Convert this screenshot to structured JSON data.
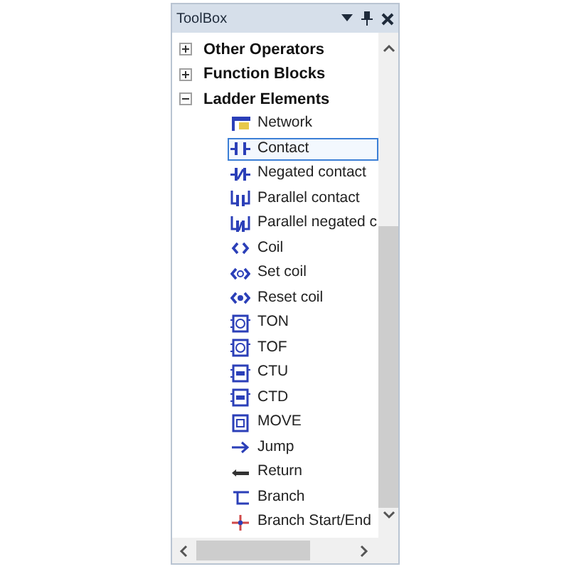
{
  "window": {
    "title": "ToolBox"
  },
  "tree": [
    {
      "label": "Other Operators",
      "expanded": false
    },
    {
      "label": "Function Blocks",
      "expanded": false
    },
    {
      "label": "Ladder Elements",
      "expanded": true,
      "children": [
        {
          "label": "Network",
          "selected": false
        },
        {
          "label": "Contact",
          "selected": true
        },
        {
          "label": "Negated contact",
          "selected": false
        },
        {
          "label": "Parallel contact",
          "selected": false
        },
        {
          "label": "Parallel negated c",
          "selected": false
        },
        {
          "label": "Coil",
          "selected": false
        },
        {
          "label": "Set coil",
          "selected": false
        },
        {
          "label": "Reset coil",
          "selected": false
        },
        {
          "label": "TON",
          "selected": false
        },
        {
          "label": "TOF",
          "selected": false
        },
        {
          "label": "CTU",
          "selected": false
        },
        {
          "label": "CTD",
          "selected": false
        },
        {
          "label": "MOVE",
          "selected": false
        },
        {
          "label": "Jump",
          "selected": false
        },
        {
          "label": "Return",
          "selected": false
        },
        {
          "label": "Branch",
          "selected": false
        },
        {
          "label": "Branch Start/End",
          "selected": false
        }
      ]
    }
  ]
}
